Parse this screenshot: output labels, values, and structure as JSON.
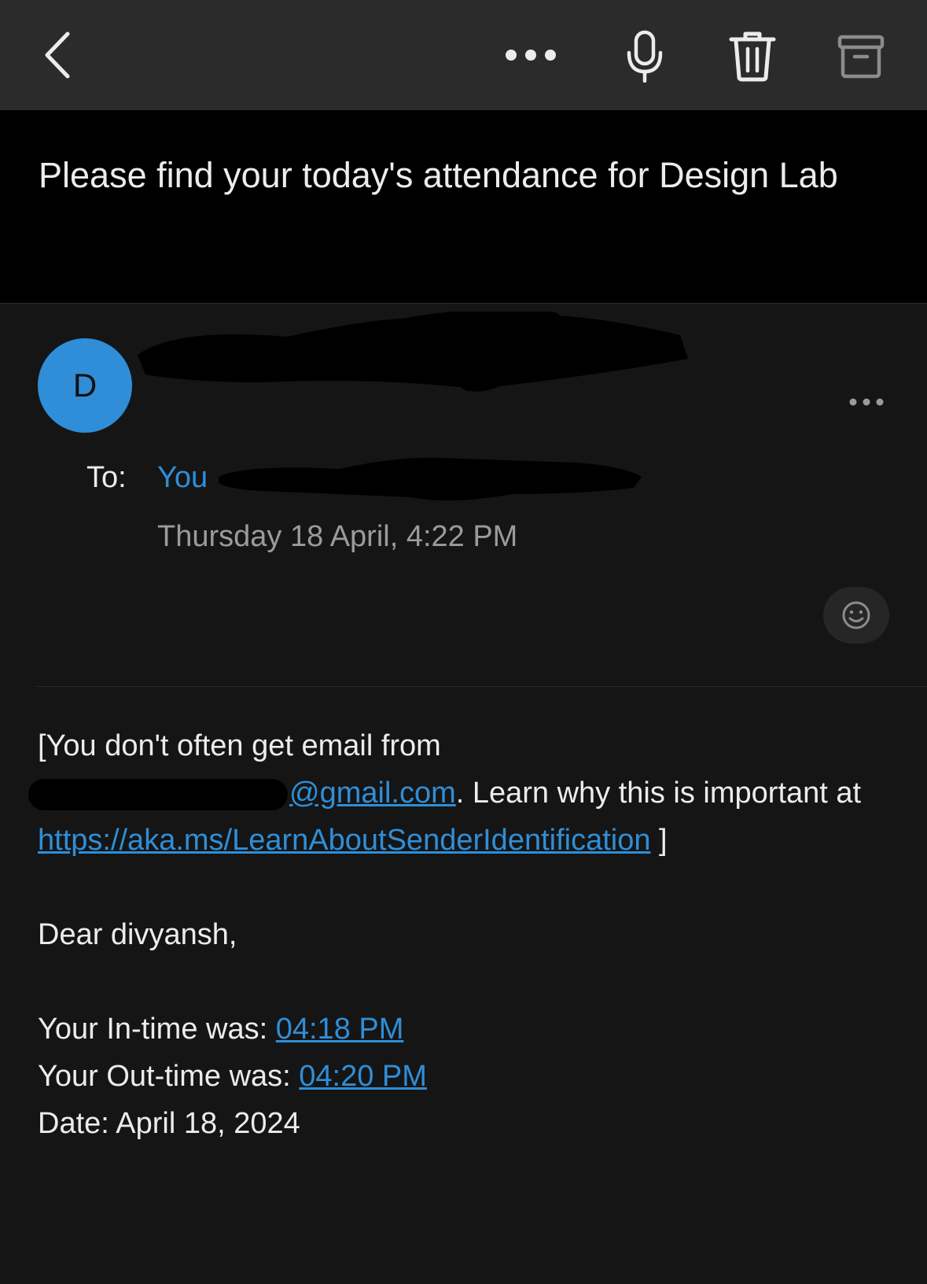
{
  "toolbar": {
    "back_icon": "chevron-left-icon",
    "more_icon": "ellipsis-icon",
    "mic_icon": "microphone-icon",
    "delete_icon": "trash-icon",
    "archive_icon": "archive-icon"
  },
  "message": {
    "subject": "Please find your today's attendance for Design Lab",
    "sender_initial": "D",
    "to_label": "To:",
    "to_value": "You",
    "date": "Thursday 18 April, 4:22 PM"
  },
  "body": {
    "notice_part1": "[You don't often get email from",
    "sender_email_suffix": "@gmail.com",
    "notice_part2": ". Learn why this is important at",
    "notice_link": "https://aka.ms/LearnAboutSenderIdentification",
    "notice_end": " ]",
    "greeting": "Dear divyansh,",
    "in_time_label": "Your In-time was: ",
    "in_time_value": "04:18 PM",
    "out_time_label": "Your Out-time was: ",
    "out_time_value": "04:20 PM",
    "date_line": "Date: April 18, 2024"
  },
  "colors": {
    "accent": "#2f8ed7",
    "toolbar_bg": "#2b2b2b",
    "page_bg": "#151515"
  }
}
